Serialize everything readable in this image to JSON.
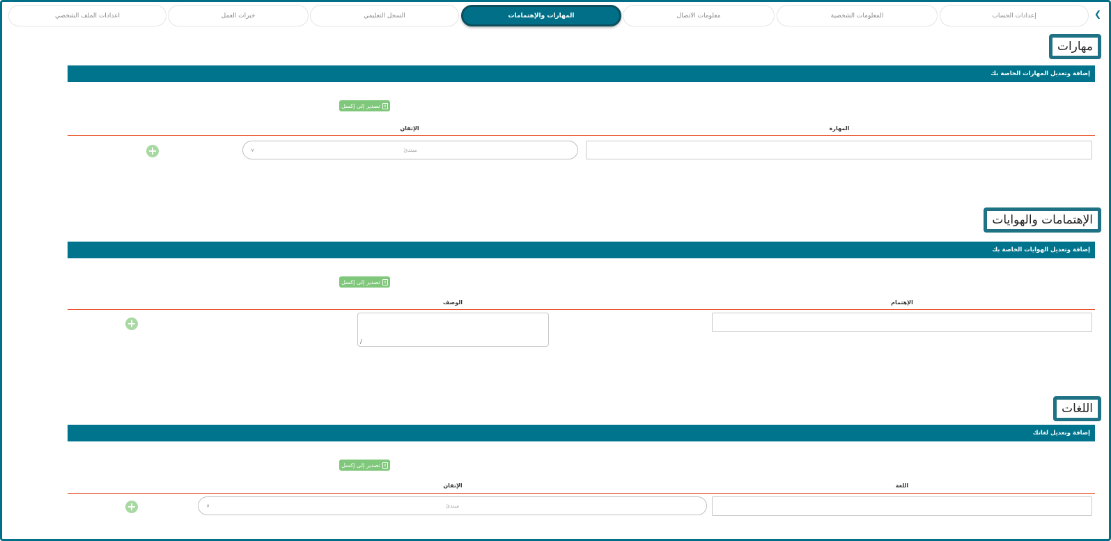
{
  "tabs": [
    {
      "label": "إعدادات الحساب"
    },
    {
      "label": "المعلومات الشخصية"
    },
    {
      "label": "معلومات الاتصال"
    },
    {
      "label": "المهارات والإهتمامات",
      "active": true
    },
    {
      "label": "السجل التعليمي"
    },
    {
      "label": "خبرات العمل"
    },
    {
      "label": "اعدادات الملف الشخصي"
    }
  ],
  "back_icon": "chevron-left-icon",
  "export_label": "تصدير إلى إكسل",
  "export_icon": "excel-file-icon",
  "add_icon": "plus-circle-icon",
  "colors": {
    "primary": "#00748c",
    "accent_line": "#e8552c",
    "export": "#7fc77a",
    "add": "#a8d9a3"
  },
  "skills": {
    "title": "مهارات",
    "bar_text": "إضافة وتعديل المهارات الخاصة بك",
    "col_skill": "المهارة",
    "col_level": "الإتقان",
    "level_value": "مبتدئ"
  },
  "interests": {
    "title": "الإهتمامات والهوايات",
    "bar_text": "إضافة وتعديل الهوايات الخاصة بك",
    "col_interest": "الإهتمام",
    "col_description": "الوصف"
  },
  "languages": {
    "title": "اللغات",
    "bar_text": "إضافة وتعديل لغاتك",
    "col_language": "اللغة",
    "col_level": "الإتقان",
    "level_value": "مبتدئ"
  }
}
